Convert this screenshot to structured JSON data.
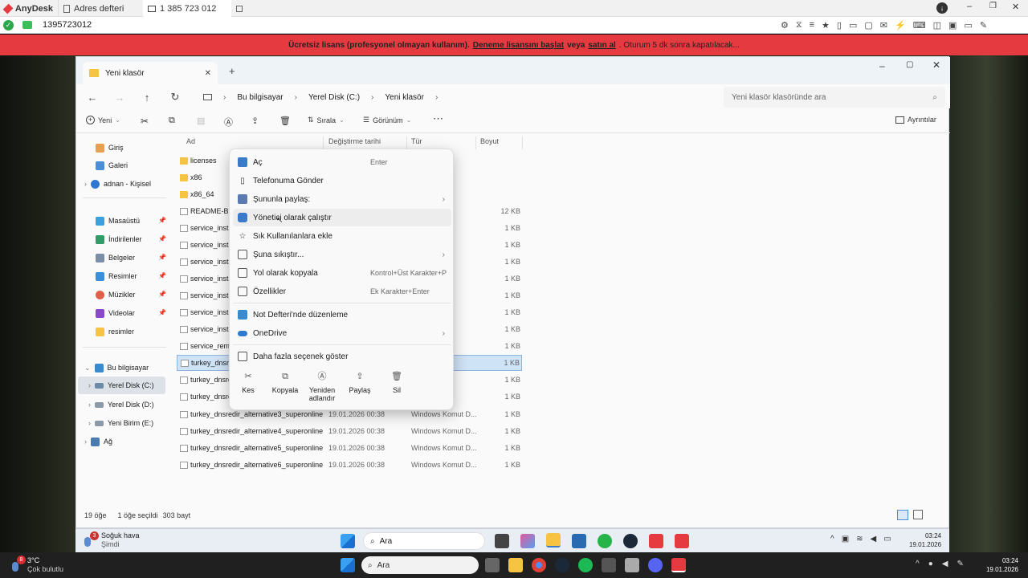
{
  "anydesk": {
    "app_name": "AnyDesk",
    "tabs": [
      "Adres defteri",
      "1 385 723 012"
    ],
    "address": "1395723012",
    "banner": {
      "text1": "Ücretsiz lisans (profesyonel olmayan kullanım).",
      "link1": "Deneme lisansını başlat",
      "text2": "veya",
      "link2": "satın al",
      "text3": ". Oturum 5 dk sonra kapatılacak..."
    }
  },
  "explorer": {
    "tab_title": "Yeni klasör",
    "breadcrumb": [
      "Bu bilgisayar",
      "Yerel Disk (C:)",
      "Yeni klasör"
    ],
    "search_placeholder": "Yeni klasör klasöründe ara",
    "commands": {
      "new": "Yeni",
      "sort": "Sırala",
      "view": "Görünüm",
      "details": "Ayrıntılar"
    },
    "columns": {
      "name": "Ad",
      "date": "Değiştirme tarihi",
      "type": "Tür",
      "size": "Boyut"
    },
    "sidebar": {
      "home": "Giriş",
      "gallery": "Galeri",
      "onedrive": "adnan - Kişisel",
      "desktop": "Masaüstü",
      "downloads": "İndirilenler",
      "documents": "Belgeler",
      "pictures": "Resimler",
      "music": "Müzikler",
      "videos": "Videolar",
      "resimler": "resimler",
      "this_pc": "Bu bilgisayar",
      "disk_c": "Yerel Disk (C:)",
      "disk_d": "Yerel Disk (D:)",
      "disk_e": "Yeni Birim (E:)",
      "network": "Ağ"
    },
    "files": [
      {
        "name": "licenses",
        "date": "",
        "type": "",
        "size": ""
      },
      {
        "name": "x86",
        "date": "",
        "type": "",
        "size": ""
      },
      {
        "name": "x86_64",
        "date": "",
        "type": "",
        "size": ""
      },
      {
        "name": "README-BE",
        "date": "",
        "type": "",
        "size": "12 KB"
      },
      {
        "name": "service_insta",
        "date": "",
        "type": "mut D...",
        "size": "1 KB"
      },
      {
        "name": "service_insta",
        "date": "",
        "type": "mut D...",
        "size": "1 KB"
      },
      {
        "name": "service_insta",
        "date": "",
        "type": "mut D...",
        "size": "1 KB"
      },
      {
        "name": "service_insta",
        "date": "",
        "type": "mut D...",
        "size": "1 KB"
      },
      {
        "name": "service_insta",
        "date": "",
        "type": "mut D...",
        "size": "1 KB"
      },
      {
        "name": "service_insta",
        "date": "",
        "type": "mut D...",
        "size": "1 KB"
      },
      {
        "name": "service_insta",
        "date": "",
        "type": "mut D...",
        "size": "1 KB"
      },
      {
        "name": "service_remo",
        "date": "",
        "type": "mut D...",
        "size": "1 KB"
      },
      {
        "name": "turkey_dnsre",
        "date": "",
        "type": "mut D...",
        "size": "1 KB"
      },
      {
        "name": "turkey_dnsre",
        "date": "",
        "type": "mut D...",
        "size": "1 KB"
      },
      {
        "name": "turkey_dnsre",
        "date": "",
        "type": "mut D...",
        "size": "1 KB"
      },
      {
        "name": "turkey_dnsredir_alternative3_superonline",
        "date": "19.01.2026 00:38",
        "type": "Windows Komut D...",
        "size": "1 KB"
      },
      {
        "name": "turkey_dnsredir_alternative4_superonline",
        "date": "19.01.2026 00:38",
        "type": "Windows Komut D...",
        "size": "1 KB"
      },
      {
        "name": "turkey_dnsredir_alternative5_superonline",
        "date": "19.01.2026 00:38",
        "type": "Windows Komut D...",
        "size": "1 KB"
      },
      {
        "name": "turkey_dnsredir_alternative6_superonline",
        "date": "19.01.2026 00:38",
        "type": "Windows Komut D...",
        "size": "1 KB"
      }
    ],
    "status": {
      "count": "19 öğe",
      "selected": "1 öğe seçildi",
      "size": "303 bayt"
    }
  },
  "context_menu": {
    "open": "Aç",
    "open_sc": "Enter",
    "send_phone": "Telefonuma Gönder",
    "share_with": "Şununla paylaş:",
    "run_admin": "Yönetici olarak çalıştır",
    "add_fav": "Sık Kullanılanlara ekle",
    "compress": "Şuna sıkıştır...",
    "copy_path": "Yol olarak kopyala",
    "copy_path_sc": "Kontrol+Üst Karakter+P",
    "properties": "Özellikler",
    "properties_sc": "Ek Karakter+Enter",
    "notepad": "Not Defteri'nde düzenleme",
    "onedrive": "OneDrive",
    "more": "Daha fazla seçenek göster",
    "cut": "Kes",
    "copy": "Kopyala",
    "rename": "Yeniden adlandır",
    "share": "Paylaş",
    "delete": "Sil"
  },
  "inner_taskbar": {
    "weather_title": "Soğuk hava",
    "weather_sub": "Şimdi",
    "weather_badge": "3",
    "search": "Ara",
    "time": "03:24",
    "date": "19.01.2026"
  },
  "local_taskbar": {
    "temp": "3°C",
    "weather": "Çok bulutlu",
    "weather_badge": "8",
    "search": "Ara",
    "time": "03:24",
    "date": "19.01.2026"
  }
}
